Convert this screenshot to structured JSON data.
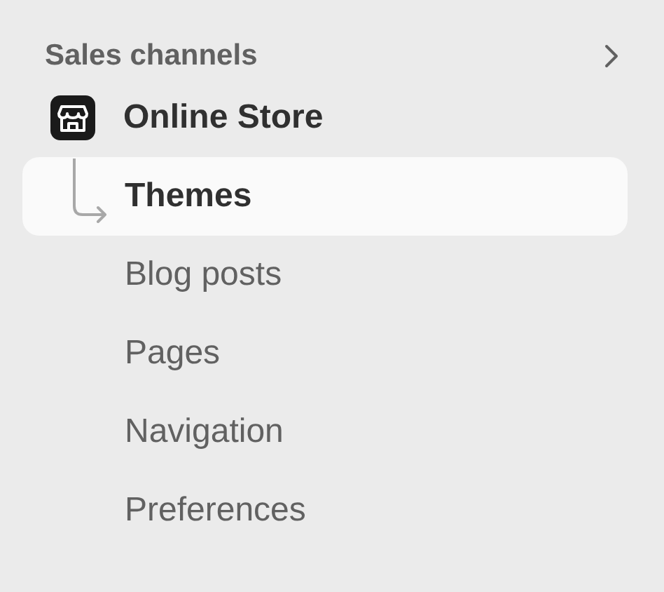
{
  "section": {
    "title": "Sales channels"
  },
  "channel": {
    "label": "Online Store"
  },
  "items": [
    {
      "label": "Themes",
      "selected": true
    },
    {
      "label": "Blog posts",
      "selected": false
    },
    {
      "label": "Pages",
      "selected": false
    },
    {
      "label": "Navigation",
      "selected": false
    },
    {
      "label": "Preferences",
      "selected": false
    }
  ]
}
